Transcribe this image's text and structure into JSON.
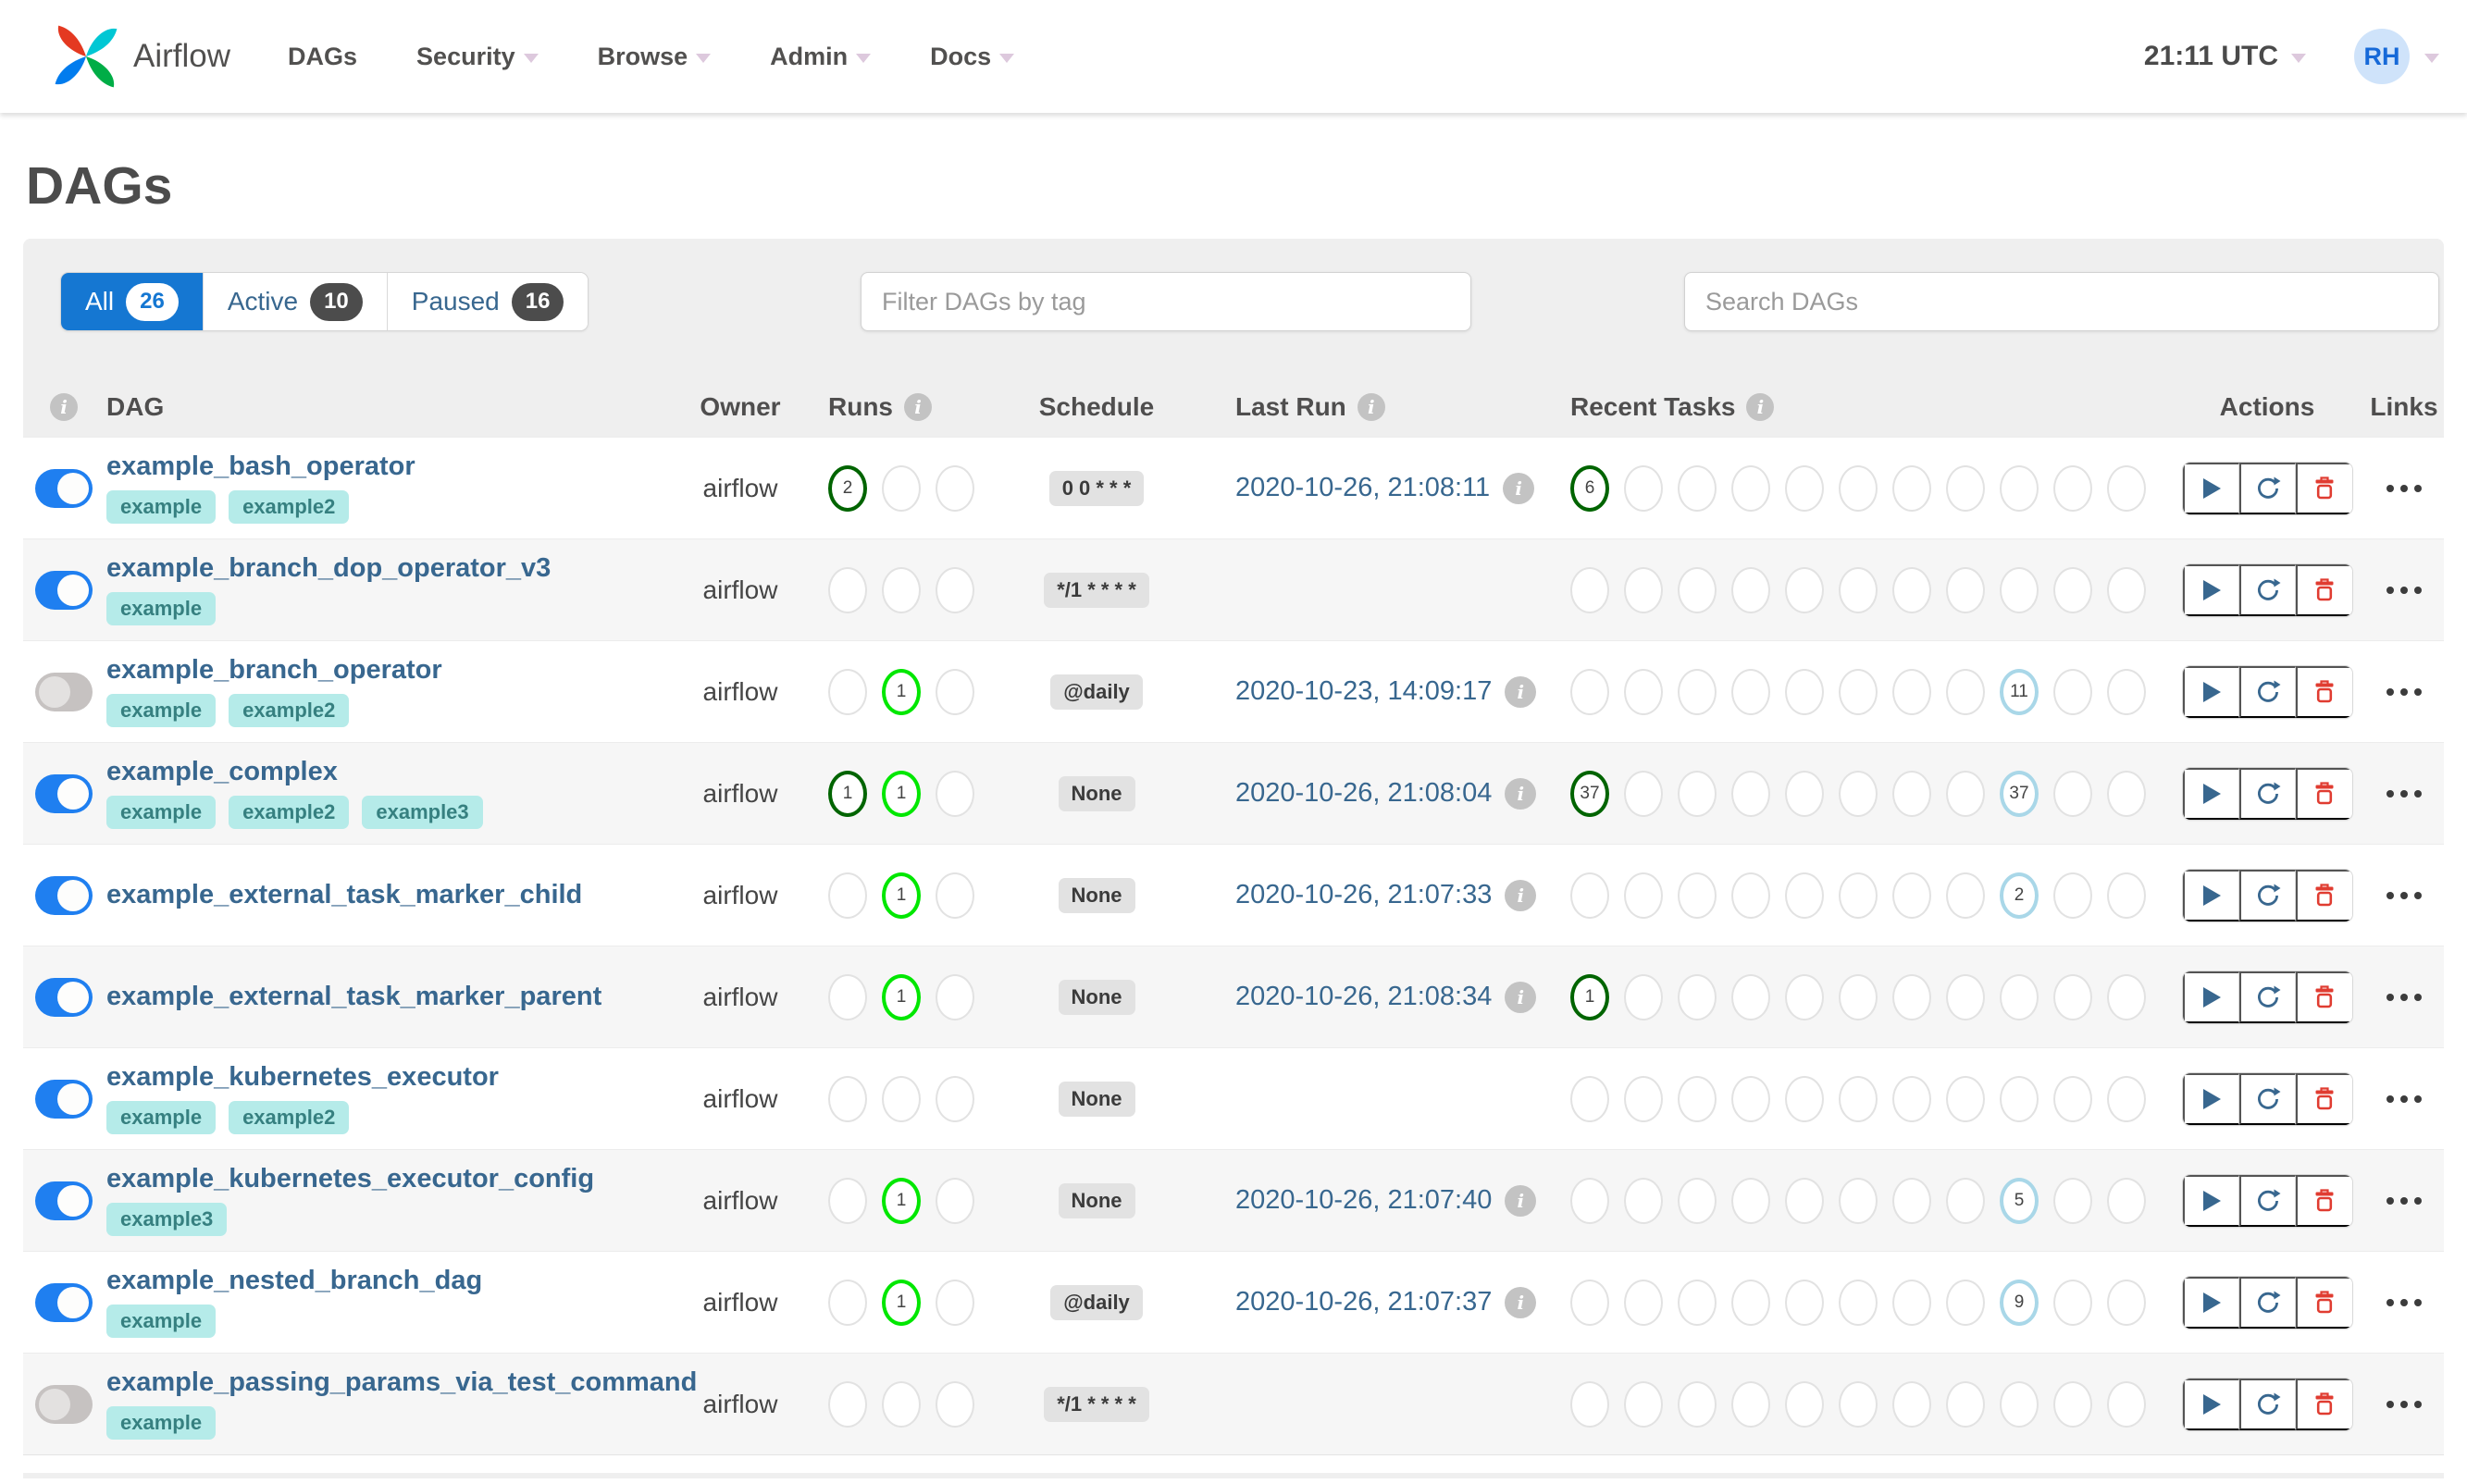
{
  "navbar": {
    "brand": "Airflow",
    "items": [
      {
        "label": "DAGs",
        "dropdown": false
      },
      {
        "label": "Security",
        "dropdown": true
      },
      {
        "label": "Browse",
        "dropdown": true
      },
      {
        "label": "Admin",
        "dropdown": true
      },
      {
        "label": "Docs",
        "dropdown": true
      }
    ],
    "clock": "21:11 UTC",
    "avatar_initials": "RH"
  },
  "page": {
    "title": "DAGs"
  },
  "tabs": [
    {
      "label": "All",
      "count": "26",
      "active": true
    },
    {
      "label": "Active",
      "count": "10",
      "active": false
    },
    {
      "label": "Paused",
      "count": "16",
      "active": false
    }
  ],
  "filters": {
    "tag_placeholder": "Filter DAGs by tag",
    "search_placeholder": "Search DAGs"
  },
  "table": {
    "headers": {
      "dag": "DAG",
      "owner": "Owner",
      "runs": "Runs",
      "schedule": "Schedule",
      "last_run": "Last Run",
      "recent_tasks": "Recent Tasks",
      "actions": "Actions",
      "links": "Links"
    },
    "run_states": [
      "success",
      "running",
      "failed"
    ],
    "task_states": [
      "success",
      "running",
      "failed",
      "upstream_failed",
      "skipped",
      "up_for_retry",
      "up_for_reschedule",
      "queued",
      "none",
      "scheduled",
      "removed"
    ],
    "rows": [
      {
        "name": "example_bash_operator",
        "enabled": true,
        "tags": [
          "example",
          "example2"
        ],
        "owner": "airflow",
        "runs": {
          "success": "2"
        },
        "schedule": "0 0 * * *",
        "last_run": "2020-10-26, 21:08:11",
        "recent_tasks": {
          "success": "6"
        }
      },
      {
        "name": "example_branch_dop_operator_v3",
        "enabled": true,
        "tags": [
          "example"
        ],
        "owner": "airflow",
        "runs": {},
        "schedule": "*/1 * * * *",
        "last_run": "",
        "recent_tasks": {}
      },
      {
        "name": "example_branch_operator",
        "enabled": false,
        "tags": [
          "example",
          "example2"
        ],
        "owner": "airflow",
        "runs": {
          "running": "1"
        },
        "schedule": "@daily",
        "last_run": "2020-10-23, 14:09:17",
        "recent_tasks": {
          "none": "11"
        }
      },
      {
        "name": "example_complex",
        "enabled": true,
        "tags": [
          "example",
          "example2",
          "example3"
        ],
        "owner": "airflow",
        "runs": {
          "success": "1",
          "running": "1"
        },
        "schedule": "None",
        "last_run": "2020-10-26, 21:08:04",
        "recent_tasks": {
          "success": "37",
          "none": "37"
        }
      },
      {
        "name": "example_external_task_marker_child",
        "enabled": true,
        "tags": [],
        "owner": "airflow",
        "runs": {
          "running": "1"
        },
        "schedule": "None",
        "last_run": "2020-10-26, 21:07:33",
        "recent_tasks": {
          "none": "2"
        }
      },
      {
        "name": "example_external_task_marker_parent",
        "enabled": true,
        "tags": [],
        "owner": "airflow",
        "runs": {
          "running": "1"
        },
        "schedule": "None",
        "last_run": "2020-10-26, 21:08:34",
        "recent_tasks": {
          "success": "1"
        }
      },
      {
        "name": "example_kubernetes_executor",
        "enabled": true,
        "tags": [
          "example",
          "example2"
        ],
        "owner": "airflow",
        "runs": {},
        "schedule": "None",
        "last_run": "",
        "recent_tasks": {}
      },
      {
        "name": "example_kubernetes_executor_config",
        "enabled": true,
        "tags": [
          "example3"
        ],
        "owner": "airflow",
        "runs": {
          "running": "1"
        },
        "schedule": "None",
        "last_run": "2020-10-26, 21:07:40",
        "recent_tasks": {
          "none": "5"
        }
      },
      {
        "name": "example_nested_branch_dag",
        "enabled": true,
        "tags": [
          "example"
        ],
        "owner": "airflow",
        "runs": {
          "running": "1"
        },
        "schedule": "@daily",
        "last_run": "2020-10-26, 21:07:37",
        "recent_tasks": {
          "none": "9"
        }
      },
      {
        "name": "example_passing_params_via_test_command",
        "enabled": false,
        "tags": [
          "example"
        ],
        "owner": "airflow",
        "runs": {},
        "schedule": "*/1 * * * *",
        "last_run": "",
        "recent_tasks": {}
      }
    ]
  },
  "colors": {
    "success": "#006400",
    "running": "#00e700",
    "none": "#a9d7e8",
    "empty_circle_border": "#e2e2e2",
    "tab_active": "#1577d2",
    "toggle_on": "#1f7ff0",
    "link": "#38678f",
    "tag_bg": "#b5ebe9",
    "tag_text": "#368080",
    "play_icon": "#38678f",
    "refresh_icon": "#38678f",
    "trash_icon": "#e03c31"
  }
}
